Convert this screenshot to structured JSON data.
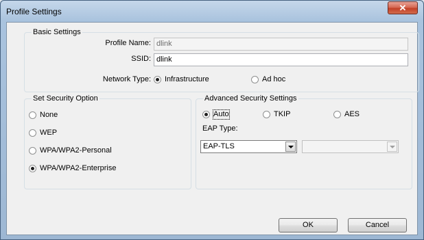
{
  "window": {
    "title": "Profile Settings"
  },
  "basic": {
    "legend": "Basic Settings",
    "profile_name_label": "Profile Name:",
    "profile_name_value": "dlink",
    "ssid_label": "SSID:",
    "ssid_value": "dlink",
    "network_type_label": "Network Type:",
    "network_types": [
      "Infrastructure",
      "Ad hoc"
    ],
    "network_type_selected": "Infrastructure"
  },
  "security": {
    "legend": "Set Security Option",
    "options": [
      "None",
      "WEP",
      "WPA/WPA2-Personal",
      "WPA/WPA2-Enterprise"
    ],
    "selected": "WPA/WPA2-Enterprise"
  },
  "advanced": {
    "legend": "Advanced Security Settings",
    "cipher_options": [
      "Auto",
      "TKIP",
      "AES"
    ],
    "cipher_selected": "Auto",
    "eap_type_label": "EAP Type:",
    "eap_type_value": "EAP-TLS",
    "secondary_value": ""
  },
  "buttons": {
    "ok": "OK",
    "cancel": "Cancel"
  }
}
